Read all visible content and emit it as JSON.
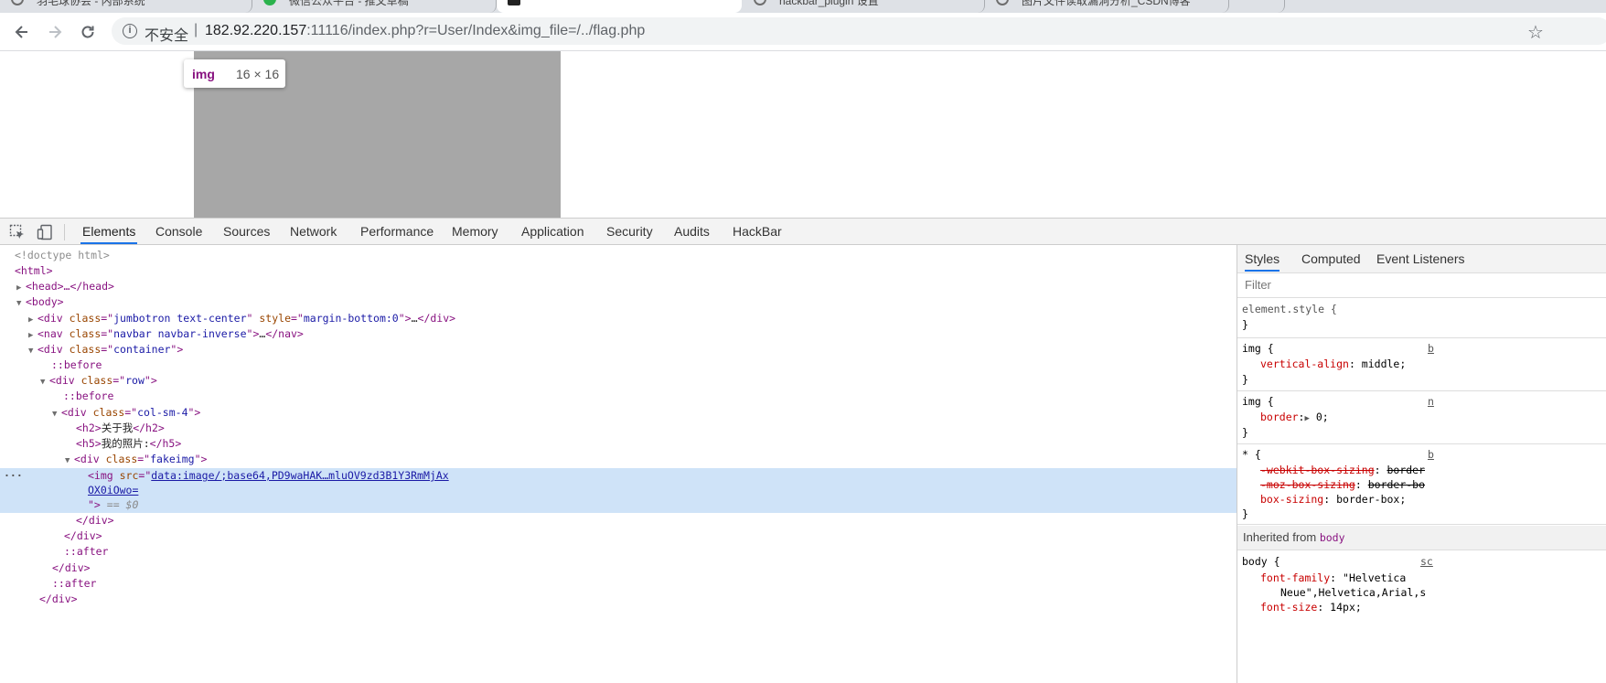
{
  "browser": {
    "tabs": [
      {
        "icon": "globe-icon",
        "label": "羽毛球协会 - 内部系统",
        "active": false
      },
      {
        "icon": "wechat-icon",
        "label": "微信公众平台 - 推文草稿",
        "active": false
      },
      {
        "icon": "terminal-icon",
        "label": "",
        "active": true
      },
      {
        "icon": "globe-icon",
        "label": "hackbar_plugin 设置",
        "active": false
      },
      {
        "icon": "globe-icon",
        "label": "图片文件读取漏洞分析_CSDN博客",
        "active": false
      }
    ],
    "address": {
      "security_label": "不安全",
      "separator": "|",
      "host": "182.92.220.157",
      "rest": ":11116/index.php?r=User/Index&img_file=/../flag.php"
    }
  },
  "viewport": {
    "tooltip_tag": "img",
    "tooltip_dims": "16 × 16"
  },
  "devtools": {
    "tabs": [
      "Elements",
      "Console",
      "Sources",
      "Network",
      "Performance",
      "Memory",
      "Application",
      "Security",
      "Audits",
      "HackBar"
    ],
    "active_tab": "Elements",
    "dom": {
      "doctype": "<!doctype html>",
      "html_open": "<html>",
      "head_line": "<head>…</head>",
      "body_open": "<body>",
      "div1_class": "jumbotron text-center",
      "div1_style": "margin-bottom:0",
      "nav_class": "navbar navbar-inverse",
      "container_class": "container",
      "before": "::before",
      "row_class": "row",
      "col_class": "col-sm-4",
      "h2_text": "关于我",
      "h5_text": "我的照片:",
      "fakeimg_class": "fakeimg",
      "img_src_1": "data:image/;base64,PD9waHAK…mluOV9zd3B1Y3RmMjAx",
      "img_src_2": "OX0iOwo=",
      "dollar_ref": "== $0",
      "after": "::after",
      "ellipsis": "…"
    },
    "styles": {
      "tabs": [
        "Styles",
        "Computed",
        "Event Listeners"
      ],
      "filter_placeholder": "Filter",
      "element_style": "element.style {",
      "rules": [
        {
          "selector": "img {",
          "prop": "vertical-align",
          "value": "middle;",
          "src": "b"
        },
        {
          "selector": "img {",
          "prop": "border",
          "value": "0;",
          "src": "n"
        },
        {
          "selector": "* {",
          "props": [
            {
              "name": "-webkit-box-sizing",
              "value": "border",
              "struck": true
            },
            {
              "name": "-moz-box-sizing",
              "value": "border-bo",
              "struck": true
            },
            {
              "name": "box-sizing",
              "value": "border-box;",
              "struck": false
            }
          ],
          "src": "b"
        }
      ],
      "inherited_label": "Inherited from",
      "inherited_from": "body",
      "body_rule": {
        "selector": "body {",
        "src": "sc",
        "font_family_name": "font-family",
        "font_family_value_1": "\"Helvetica",
        "font_family_value_2": "Neue\",Helvetica,Arial,s",
        "font_size_name": "font-size",
        "font_size_value": "14px;"
      }
    }
  }
}
